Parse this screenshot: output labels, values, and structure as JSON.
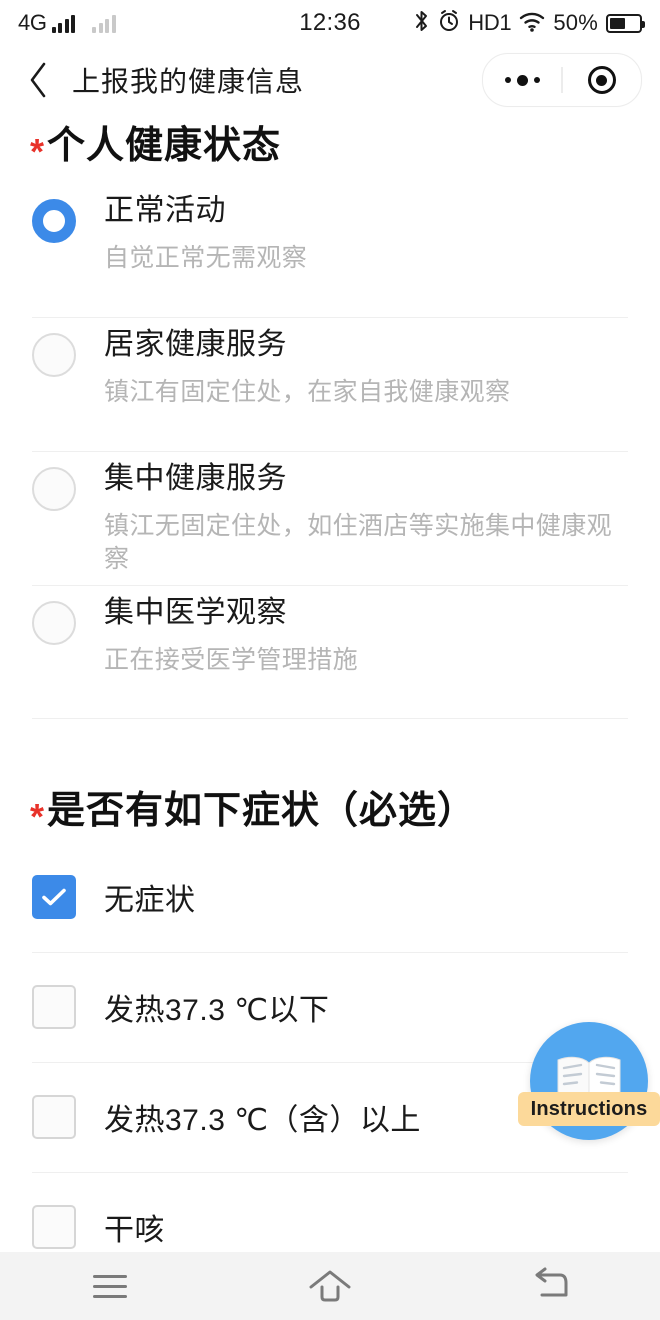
{
  "status_bar": {
    "network": "4G",
    "time": "12:36",
    "bluetooth_icon": "bluetooth-icon",
    "alarm_icon": "alarm-icon",
    "hd_label": "HD1",
    "wifi_icon": "wifi-icon",
    "battery_percent": "50%"
  },
  "navbar": {
    "back_icon": "back-chevron-icon",
    "title": "上报我的健康信息",
    "more_icon": "more-dots-icon",
    "capsule_target_icon": "target-circle-icon"
  },
  "health_status": {
    "required_marker": "*",
    "title": "个人健康状态",
    "options": [
      {
        "label": "正常活动",
        "sub": "自觉正常无需观察",
        "selected": true
      },
      {
        "label": "居家健康服务",
        "sub": "镇江有固定住处，在家自我健康观察",
        "selected": false
      },
      {
        "label": "集中健康服务",
        "sub": "镇江无固定住处，如住酒店等实施集中健康观察",
        "selected": false
      },
      {
        "label": "集中医学观察",
        "sub": "正在接受医学管理措施",
        "selected": false
      }
    ]
  },
  "symptoms": {
    "required_marker": "*",
    "title": "是否有如下症状（必选）",
    "options": [
      {
        "label": "无症状",
        "checked": true
      },
      {
        "label": "发热37.3 ℃以下",
        "checked": false
      },
      {
        "label": "发热37.3 ℃（含）以上",
        "checked": false
      },
      {
        "label": "干咳",
        "checked": false
      }
    ]
  },
  "floating_button": {
    "label": "Instructions",
    "icon": "open-book-icon"
  },
  "bottom_nav": {
    "items": [
      {
        "icon": "menu-icon"
      },
      {
        "icon": "home-icon"
      },
      {
        "icon": "back-arrow-icon"
      }
    ]
  },
  "colors": {
    "accent_blue": "#3c8ae8",
    "required_red": "#e8322a",
    "badge_orange": "#fcd99a",
    "fab_blue": "#52a7ef"
  }
}
